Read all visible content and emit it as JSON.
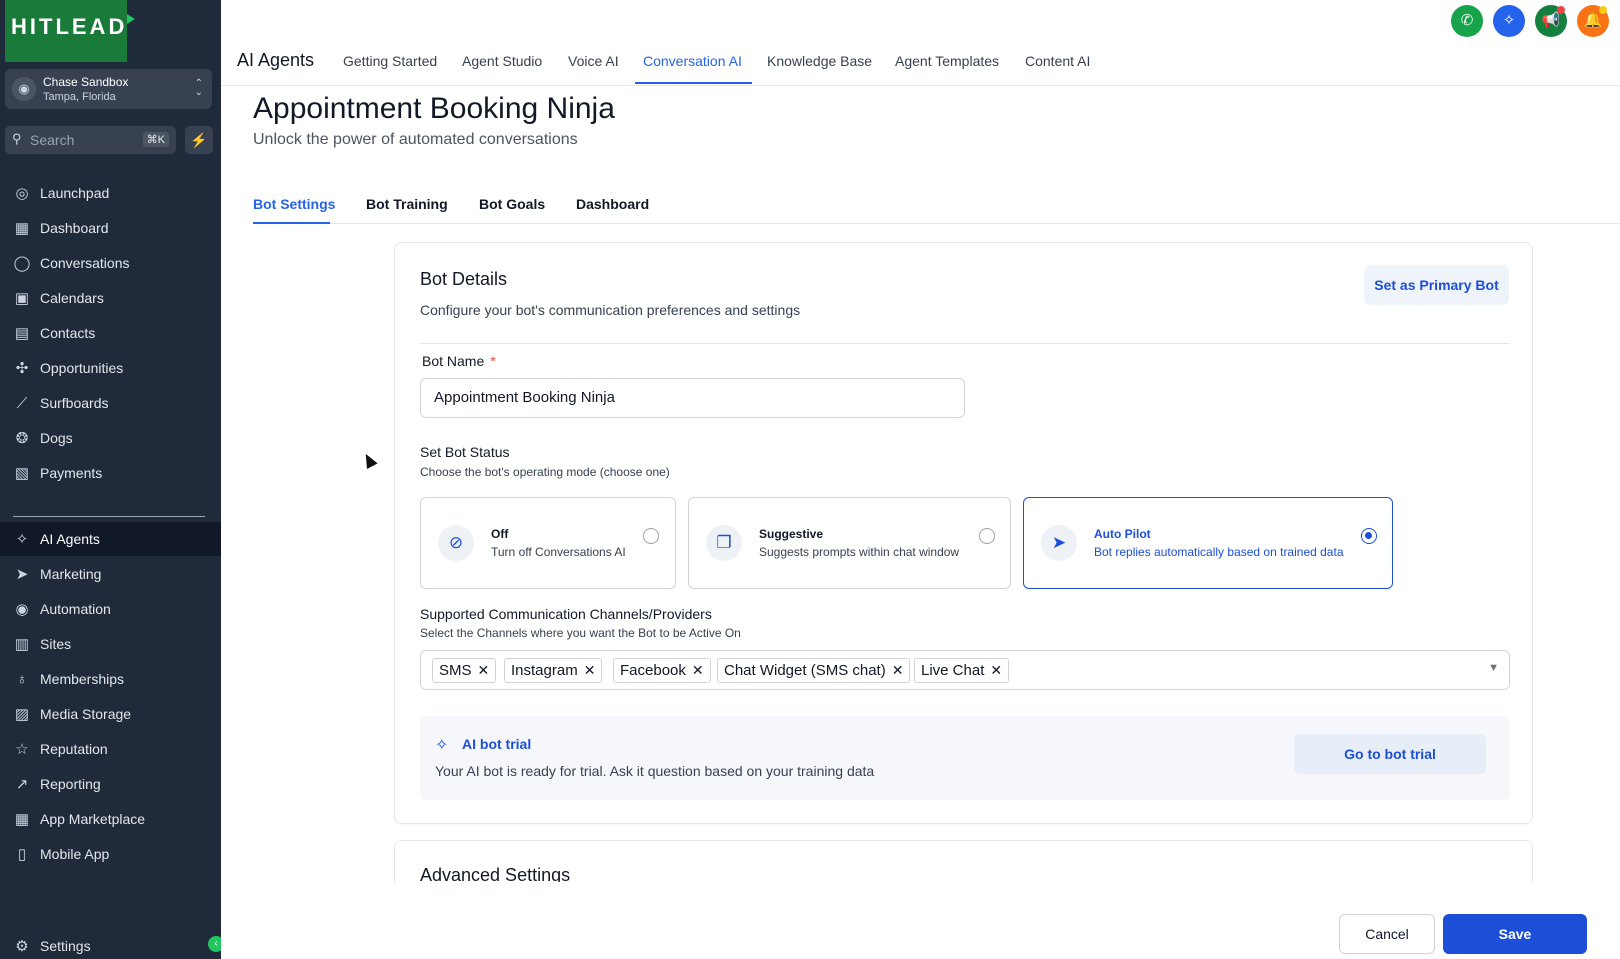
{
  "brand": {
    "logo": "HITLEAD",
    "accent": "#1a7a3a",
    "primary": "#1d4ed8"
  },
  "account": {
    "name": "Chase Sandbox",
    "location": "Tampa, Florida"
  },
  "search": {
    "placeholder": "Search",
    "shortcut": "⌘K"
  },
  "sidebar": {
    "items": [
      {
        "label": "Launchpad",
        "icon": "launchpad-icon"
      },
      {
        "label": "Dashboard",
        "icon": "grid-icon"
      },
      {
        "label": "Conversations",
        "icon": "chat-icon"
      },
      {
        "label": "Calendars",
        "icon": "calendar-icon"
      },
      {
        "label": "Contacts",
        "icon": "contacts-icon"
      },
      {
        "label": "Opportunities",
        "icon": "opportunities-icon"
      },
      {
        "label": "Surfboards",
        "icon": "surfboard-icon"
      },
      {
        "label": "Dogs",
        "icon": "dog-icon"
      },
      {
        "label": "Payments",
        "icon": "payments-icon"
      },
      {
        "label": "AI Agents",
        "icon": "sparkle-icon"
      },
      {
        "label": "Marketing",
        "icon": "send-icon"
      },
      {
        "label": "Automation",
        "icon": "automation-icon"
      },
      {
        "label": "Sites",
        "icon": "sites-icon"
      },
      {
        "label": "Memberships",
        "icon": "membership-icon"
      },
      {
        "label": "Media Storage",
        "icon": "image-icon"
      },
      {
        "label": "Reputation",
        "icon": "star-icon"
      },
      {
        "label": "Reporting",
        "icon": "chart-icon"
      },
      {
        "label": "App Marketplace",
        "icon": "apps-icon"
      },
      {
        "label": "Mobile App",
        "icon": "mobile-icon"
      },
      {
        "label": "Settings",
        "icon": "gear-icon"
      }
    ]
  },
  "header": {
    "title": "AI Agents",
    "tabs": [
      "Getting Started",
      "Agent Studio",
      "Voice AI",
      "Conversation AI",
      "Knowledge Base",
      "Agent Templates",
      "Content AI"
    ],
    "active_tab": "Conversation AI"
  },
  "page": {
    "title": "Appointment Booking Ninja",
    "subtitle": "Unlock the power of automated conversations",
    "tabs": [
      "Bot Settings",
      "Bot Training",
      "Bot Goals",
      "Dashboard"
    ],
    "active_tab": "Bot Settings"
  },
  "bot_details": {
    "title": "Bot Details",
    "subtitle": "Configure your bot's communication preferences and settings",
    "primary_button": "Set as Primary Bot",
    "name_label": "Bot Name",
    "required_mark": "*",
    "name_value": "Appointment Booking Ninja",
    "status_label": "Set Bot Status",
    "status_sub": "Choose the bot's operating mode (choose one)",
    "status_options": [
      {
        "title": "Off",
        "desc": "Turn off Conversations AI",
        "selected": false
      },
      {
        "title": "Suggestive",
        "desc": "Suggests prompts within chat window",
        "selected": false
      },
      {
        "title": "Auto Pilot",
        "desc": "Bot replies automatically based on trained data",
        "selected": true
      }
    ],
    "channels_label": "Supported Communication Channels/Providers",
    "channels_sub": "Select the Channels where you want the Bot to be Active On",
    "channels": [
      "SMS",
      "Instagram",
      "Facebook",
      "Chat Widget (SMS chat)",
      "Live Chat"
    ],
    "trial": {
      "title": "AI bot trial",
      "desc": "Your AI bot is ready for trial. Ask it question based on your training data",
      "button": "Go to bot trial"
    }
  },
  "advanced": {
    "title": "Advanced Settings"
  },
  "footer": {
    "cancel": "Cancel",
    "save": "Save"
  }
}
